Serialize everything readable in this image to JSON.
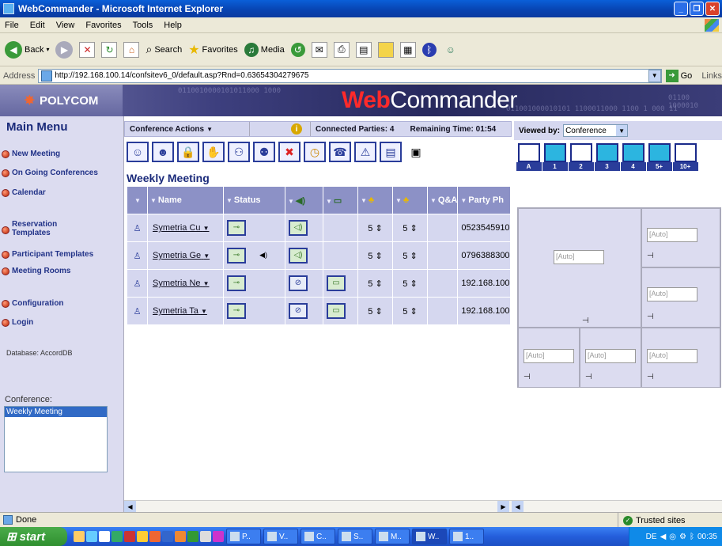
{
  "window": {
    "title": "WebCommander - Microsoft Internet Explorer"
  },
  "menubar": [
    "File",
    "Edit",
    "View",
    "Favorites",
    "Tools",
    "Help"
  ],
  "toolbar": {
    "back": "Back",
    "search": "Search",
    "favorites": "Favorites",
    "media": "Media"
  },
  "address": {
    "label": "Address",
    "url": "http://192.168.100.14/confsitev6_0/default.asp?Rnd=0.63654304279675",
    "go": "Go",
    "links": "Links"
  },
  "banner": {
    "logo": "POLYCOM",
    "brand_accent": "Web",
    "brand_rest": "Commander",
    "digits1": "0110010000101011000 1000",
    "digits2": "011001000010101 1100011000 1100 1 000 11",
    "digits3": "01100 1000010"
  },
  "leftmenu": {
    "title": "Main Menu",
    "items": [
      {
        "label": "New Meeting"
      },
      {
        "label": "On Going Conferences"
      },
      {
        "label": "Calendar"
      },
      {
        "label": "Reservation Templates"
      },
      {
        "label": "Participant Templates"
      },
      {
        "label": "Meeting Rooms"
      },
      {
        "label": "Configuration"
      },
      {
        "label": "Login"
      }
    ],
    "database": "Database: AccordDB",
    "conference_label": "Conference:",
    "conference_selected": "Weekly Meeting"
  },
  "actionbar": {
    "actions": "Conference Actions",
    "connected": "Connected Parties: 4",
    "remaining": "Remaining Time: 01:54"
  },
  "meeting": {
    "title": "Weekly Meeting"
  },
  "grid": {
    "headers": [
      "",
      "Name",
      "Status",
      "",
      "",
      "",
      "",
      "Q&A",
      "Party Ph"
    ],
    "rows": [
      {
        "name": "Symetria Cu",
        "v1": "5",
        "v2": "5",
        "phone": "0523545910"
      },
      {
        "name": "Symetria Ge",
        "v1": "5",
        "v2": "5",
        "phone": "0796388300"
      },
      {
        "name": "Symetria Ne",
        "v1": "5",
        "v2": "5",
        "phone": "192.168.100"
      },
      {
        "name": "Symetria Ta",
        "v1": "5",
        "v2": "5",
        "phone": "192.168.100"
      }
    ]
  },
  "rightpanel": {
    "viewed_by": "Viewed by:",
    "view_value": "Conference",
    "layouts": [
      "A",
      "1",
      "2",
      "3",
      "4",
      "5+",
      "10+"
    ],
    "auto": "[Auto]"
  },
  "statusbar": {
    "status": "Done",
    "zone": "Trusted sites"
  },
  "taskbar": {
    "start": "start",
    "tasks": [
      "P..",
      "V..",
      "C..",
      "S..",
      "M..",
      "W..",
      "1.."
    ],
    "tray_lang": "DE",
    "clock": "00:35"
  },
  "colors": {
    "titlebar": "#0842b0",
    "banner": "#27295d",
    "grid_header": "#8c91c6",
    "grid_cell": "#d5d7ef",
    "brand_accent": "#ff2a2a"
  }
}
